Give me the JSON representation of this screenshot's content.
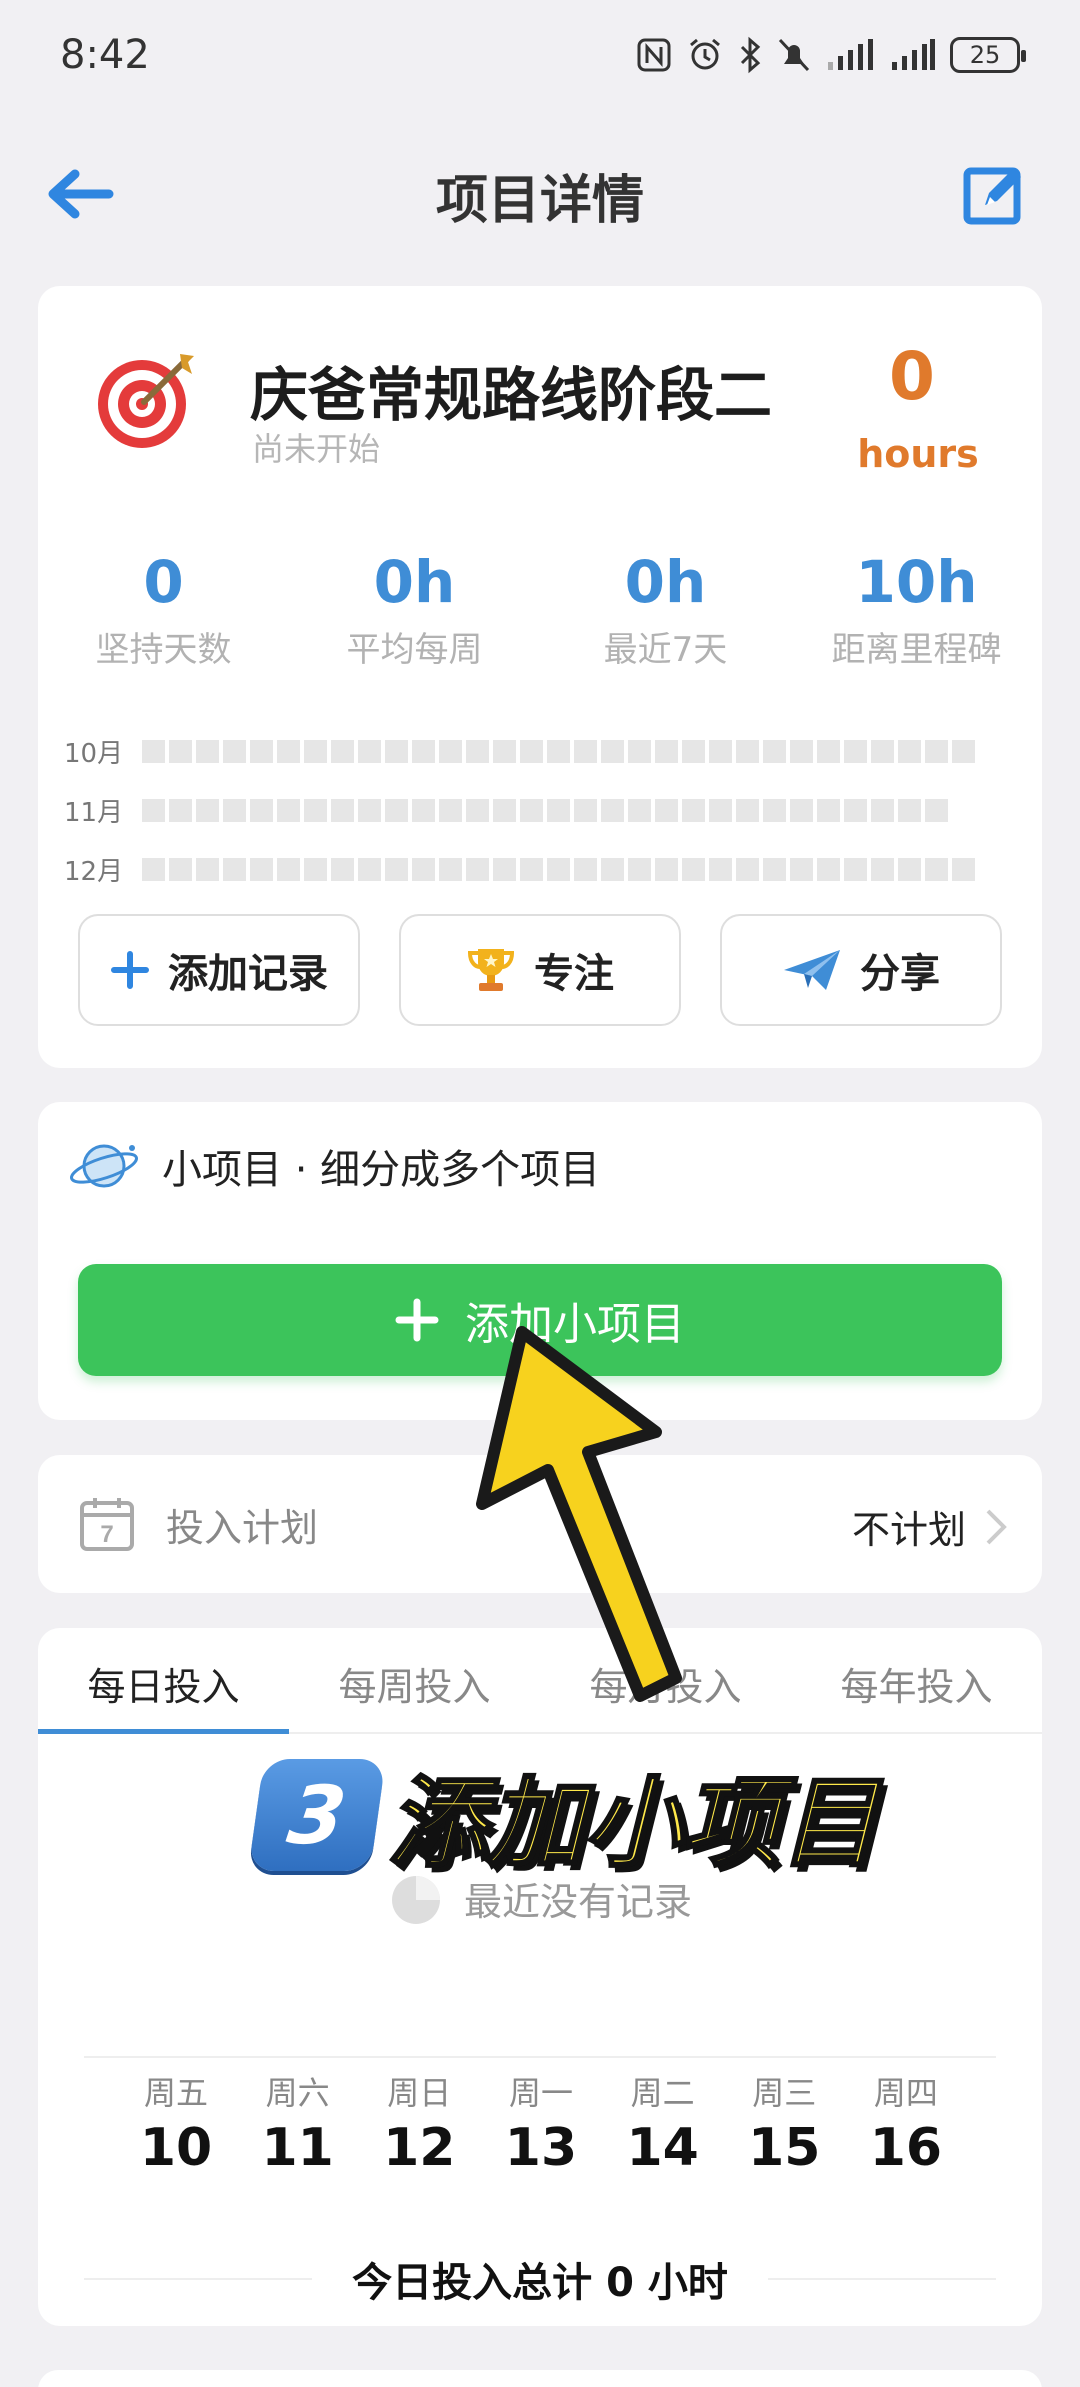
{
  "status_bar": {
    "time": "8:42",
    "battery": "25"
  },
  "header": {
    "title": "项目详情",
    "back_icon": "arrow-left-icon",
    "edit_icon": "edit-icon"
  },
  "project": {
    "icon": "target-icon",
    "name": "庆爸常规路线阶段二",
    "status": "尚未开始",
    "hours_value": "0",
    "hours_unit": "hours",
    "stats": [
      {
        "value": "0",
        "label": "坚持天数"
      },
      {
        "value": "0h",
        "label": "平均每周"
      },
      {
        "value": "0h",
        "label": "最近7天"
      },
      {
        "value": "10h",
        "label": "距离里程碑"
      }
    ],
    "heatmap": [
      {
        "month": "10月",
        "cells": 31
      },
      {
        "month": "11月",
        "cells": 30
      },
      {
        "month": "12月",
        "cells": 31
      }
    ],
    "actions": [
      {
        "label": "添加记录",
        "icon": "plus-icon"
      },
      {
        "label": "专注",
        "icon": "trophy-icon"
      },
      {
        "label": "分享",
        "icon": "send-icon"
      }
    ]
  },
  "subprojects": {
    "icon": "planet-icon",
    "heading": "小项目 · 细分成多个项目",
    "add_button": "添加小项目"
  },
  "plan": {
    "icon": "calendar-icon",
    "label": "投入计划",
    "value": "不计划"
  },
  "investment": {
    "tabs": [
      "每日投入",
      "每周投入",
      "每月投入",
      "每年投入"
    ],
    "active_tab": 0,
    "empty_text": "最近没有记录",
    "days": [
      {
        "weekday": "周五",
        "date": "10"
      },
      {
        "weekday": "周六",
        "date": "11"
      },
      {
        "weekday": "周日",
        "date": "12"
      },
      {
        "weekday": "周一",
        "date": "13"
      },
      {
        "weekday": "周二",
        "date": "14"
      },
      {
        "weekday": "周三",
        "date": "15"
      },
      {
        "weekday": "周四",
        "date": "16"
      }
    ],
    "total_text": "今日投入总计 0 小时"
  },
  "overlay": {
    "step_number": "3",
    "caption": "添加小项目"
  },
  "colors": {
    "accent_blue": "#3f8dd6",
    "orange": "#e07a2c",
    "green": "#3cc45b",
    "caption_yellow": "#ffe94a"
  }
}
